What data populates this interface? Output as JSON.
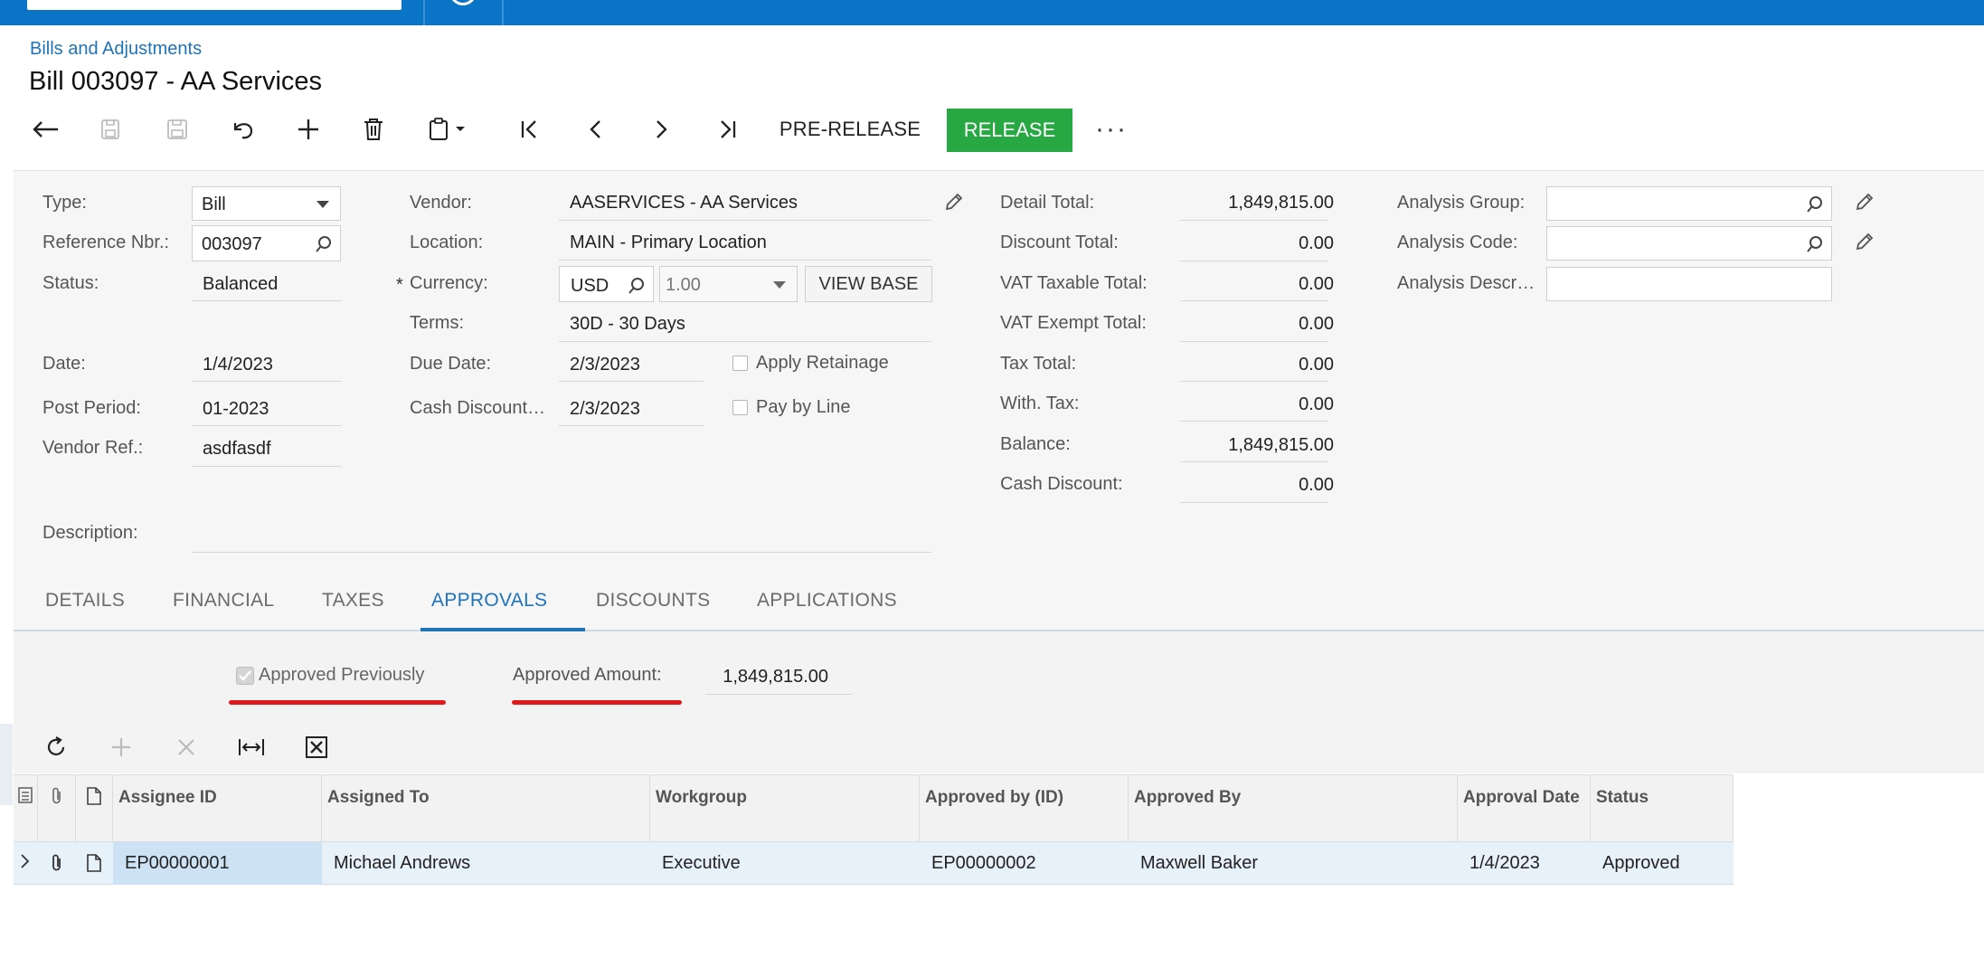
{
  "breadcrumb": "Bills and Adjustments",
  "page_title": "Bill 003097 - AA Services",
  "toolbar": {
    "pre_release": "PRE-RELEASE",
    "release": "RELEASE",
    "more": "···"
  },
  "form": {
    "type_label": "Type:",
    "type_value": "Bill",
    "ref_label": "Reference Nbr.:",
    "ref_value": "003097",
    "status_label": "Status:",
    "status_value": "Balanced",
    "date_label": "Date:",
    "date_value": "1/4/2023",
    "post_period_label": "Post Period:",
    "post_period_value": "01-2023",
    "vendor_ref_label": "Vendor Ref.:",
    "vendor_ref_value": "asdfasdf",
    "description_label": "Description:",
    "vendor_label": "Vendor:",
    "vendor_value": "AASERVICES - AA Services",
    "location_label": "Location:",
    "location_value": "MAIN - Primary Location",
    "currency_label": "Currency:",
    "currency_value": "USD",
    "rate_value": "1.00",
    "view_base": "VIEW BASE",
    "terms_label": "Terms:",
    "terms_value": "30D - 30 Days",
    "due_date_label": "Due Date:",
    "due_date_value": "2/3/2023",
    "cash_discount_date_label": "Cash Discount…",
    "cash_discount_date_value": "2/3/2023",
    "apply_retainage": "Apply Retainage",
    "pay_by_line": "Pay by Line",
    "detail_total_label": "Detail Total:",
    "detail_total_value": "1,849,815.00",
    "discount_total_label": "Discount Total:",
    "discount_total_value": "0.00",
    "vat_taxable_label": "VAT Taxable Total:",
    "vat_taxable_value": "0.00",
    "vat_exempt_label": "VAT Exempt Total:",
    "vat_exempt_value": "0.00",
    "tax_total_label": "Tax Total:",
    "tax_total_value": "0.00",
    "with_tax_label": "With. Tax:",
    "with_tax_value": "0.00",
    "balance_label": "Balance:",
    "balance_value": "1,849,815.00",
    "cash_discount_label": "Cash Discount:",
    "cash_discount_value": "0.00",
    "analysis_group_label": "Analysis Group:",
    "analysis_code_label": "Analysis Code:",
    "analysis_descr_label": "Analysis Descr…"
  },
  "tabs": [
    "DETAILS",
    "FINANCIAL",
    "TAXES",
    "APPROVALS",
    "DISCOUNTS",
    "APPLICATIONS"
  ],
  "active_tab": "APPROVALS",
  "approvals": {
    "approved_previously_label": "Approved Previously",
    "approved_previously_checked": true,
    "approved_amount_label": "Approved Amount:",
    "approved_amount_value": "1,849,815.00"
  },
  "grid": {
    "columns": [
      "Assignee ID",
      "Assigned To",
      "Workgroup",
      "Approved by (ID)",
      "Approved By",
      "Approval Date",
      "Status"
    ],
    "rows": [
      {
        "assignee_id": "EP00000001",
        "assigned_to": "Michael Andrews",
        "workgroup": "Executive",
        "approved_by_id": "EP00000002",
        "approved_by": "Maxwell Baker",
        "approval_date": "1/4/2023",
        "status": "Approved"
      }
    ]
  },
  "colors": {
    "topbar": "#0a74c7",
    "link": "#1f73b7",
    "release": "#27a843",
    "highlight": "#e2191b",
    "row_selected": "#e7f1fa"
  }
}
